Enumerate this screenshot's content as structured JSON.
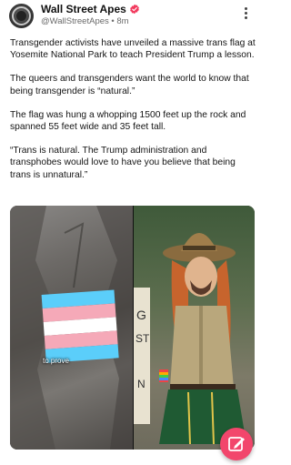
{
  "author": {
    "name": "Wall Street Apes",
    "handle": "@WallStreetApes",
    "separator": "•",
    "time": "8m",
    "verified_color": "#f23a5e"
  },
  "post": {
    "paragraphs": [
      "Transgender activists have unveiled a massive trans flag at Yosemite National Park to teach President Trump a lesson.",
      "The queers and transgenders want the world to know that being transgender is “natural.”",
      "The flag was hung a whopping 1500 feet up the rock and spanned 55 feet wide and 35 feet tall.",
      "“Trans is natural. The Trump administration and transphobes would love to have you believe that being trans is unnatural.”"
    ]
  },
  "media": {
    "caption": "to prove",
    "flag_colors": [
      "#5bcefa",
      "#f5a9b8",
      "#ffffff"
    ],
    "sign_letters": [
      "G",
      "ST",
      "N"
    ]
  },
  "icons": {
    "more": "more-vertical-icon",
    "compose": "compose-icon",
    "verified": "verified-badge-icon"
  },
  "colors": {
    "accent": "#f2466c"
  }
}
